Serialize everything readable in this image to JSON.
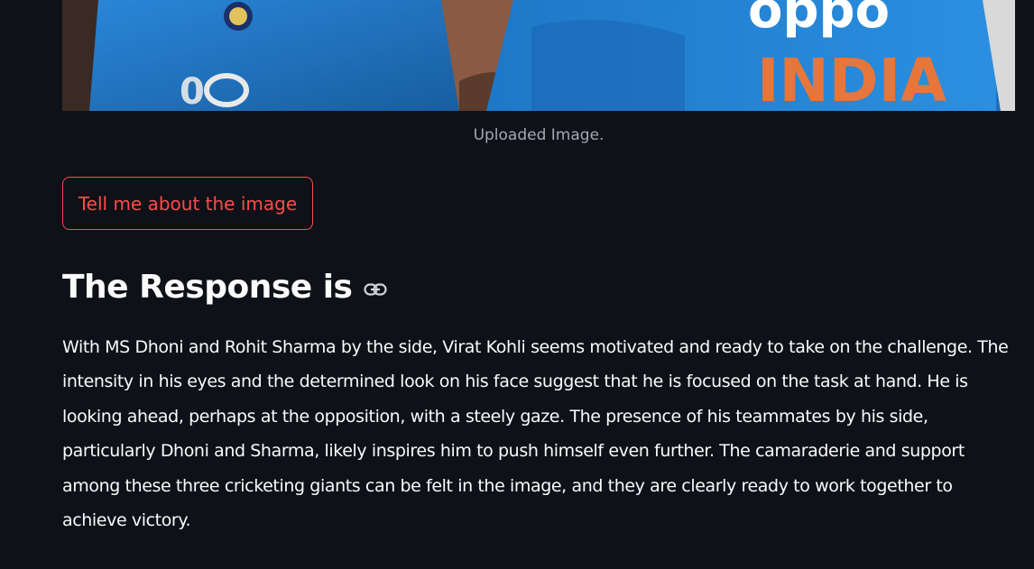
{
  "image": {
    "caption": "Uploaded Image.",
    "jersey_text": "INDIA",
    "sponsor_text": "oppo",
    "colors": {
      "jersey_blue": "#1b6fc0",
      "jersey_text": "#e8763a",
      "background": "#0e1117"
    }
  },
  "action_button": {
    "label": "Tell me about the image",
    "accent": "#ff4b4b"
  },
  "response": {
    "heading": "The Response is",
    "link_icon": "link-icon",
    "text": "With MS Dhoni and Rohit Sharma by the side, Virat Kohli seems motivated and ready to take on the challenge. The intensity in his eyes and the determined look on his face suggest that he is focused on the task at hand. He is looking ahead, perhaps at the opposition, with a steely gaze. The presence of his teammates by his side, particularly Dhoni and Sharma, likely inspires him to push himself even further. The camaraderie and support among these three cricketing giants can be felt in the image, and they are clearly ready to work together to achieve victory."
  }
}
